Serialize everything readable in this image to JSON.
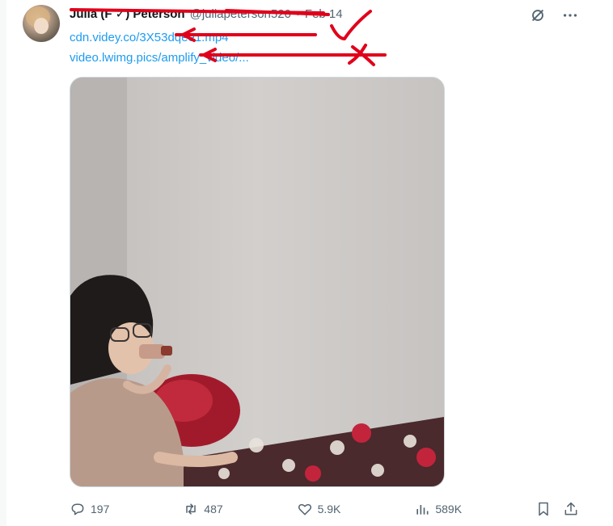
{
  "tweet": {
    "display_name": "Julia (F ✓) Peterson",
    "handle": "@juliapeterson520",
    "dot": "·",
    "time": "Feb 14",
    "links": [
      "cdn.videy.co/3X53dqee1.mp4",
      "video.lwimg.pics/amplify_video/..."
    ]
  },
  "actions": {
    "replies": "197",
    "reposts": "487",
    "likes": "5.9K",
    "views": "589K"
  },
  "icons": {
    "grok": "grok-icon",
    "more": "more-icon",
    "reply": "reply-icon",
    "repost": "repost-icon",
    "like": "like-icon",
    "views": "views-icon",
    "bookmark": "bookmark-icon",
    "share": "share-icon"
  },
  "colors": {
    "link": "#1d9bf0",
    "muted": "#536471",
    "annotation": "#e0001b"
  }
}
